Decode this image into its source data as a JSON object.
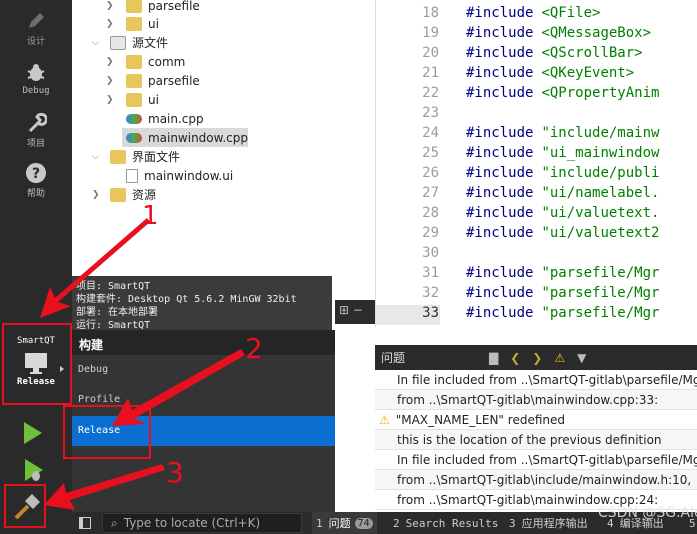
{
  "modes": [
    {
      "label": "设计",
      "icon": "design-pencil-icon"
    },
    {
      "label": "Debug",
      "icon": "bug-icon"
    },
    {
      "label": "项目",
      "icon": "wrench-icon"
    },
    {
      "label": "帮助",
      "icon": "help-icon"
    }
  ],
  "tree": {
    "rows": [
      "parsefile",
      "ui",
      "源文件",
      "comm",
      "parsefile",
      "ui",
      "main.cpp",
      "mainwindow.cpp",
      "界面文件",
      "mainwindow.ui",
      "资源"
    ]
  },
  "editor": {
    "line_numbers": [
      "18",
      "19",
      "20",
      "21",
      "22",
      "23",
      "24",
      "25",
      "26",
      "27",
      "28",
      "29",
      "30",
      "31",
      "32",
      "33"
    ],
    "include_kw": "#include",
    "lines": [
      "<QFile>",
      "<QMessageBox>",
      "<QScrollBar>",
      "<QKeyEvent>",
      "<QPropertyAnim",
      "",
      "\"include/mainw",
      "\"ui_mainwindow",
      "\"include/publi",
      "\"ui/namelabel.",
      "\"ui/valuetext.",
      "\"ui/valuetext2",
      "",
      "\"parsefile/Mgr",
      "\"parsefile/Mgr",
      "\"parsefile/Mgr"
    ]
  },
  "tooltip": {
    "lines": [
      "项目: SmartQT",
      "构建套件: Desktop Qt 5.6.2 MinGW 32bit",
      "部署: 在本地部署",
      "运行: SmartQT"
    ]
  },
  "kit_selector": {
    "project": "SmartQT",
    "build": "Release"
  },
  "build_menu": {
    "header": "构建",
    "options": [
      "Debug",
      "Profile",
      "Release"
    ],
    "selected": "Release"
  },
  "issues_panel": {
    "title": "问题",
    "rows": [
      {
        "text": "In file included from ..\\SmartQT-gitlab\\parsefile/Mg",
        "warning": false
      },
      {
        "text": "from ..\\SmartQT-gitlab\\mainwindow.cpp:33:",
        "warning": false
      },
      {
        "text": "\"MAX_NAME_LEN\" redefined",
        "warning": true
      },
      {
        "text": "this is the location of the previous definition",
        "warning": false
      },
      {
        "text": "In file included from ..\\SmartQT-gitlab\\parsefile/Mgr",
        "warning": false
      },
      {
        "text": "from ..\\SmartQT-gitlab\\include/mainwindow.h:10,",
        "warning": false
      },
      {
        "text": "from ..\\SmartQT-gitlab\\mainwindow.cpp:24:",
        "warning": false
      }
    ]
  },
  "bottom_bar": {
    "locate_placeholder": "Type to locate (Ctrl+K)",
    "tabs": [
      {
        "num": "1",
        "label": "问题",
        "badge": "74"
      },
      {
        "num": "2",
        "label": "Search Results"
      },
      {
        "num": "3",
        "label": "应用程序输出"
      },
      {
        "num": "4",
        "label": "编译输出"
      },
      {
        "num": "5",
        "label": ""
      }
    ]
  },
  "annotations": [
    "1",
    "2",
    "3"
  ],
  "watermark": "CSDN @SG.Alex",
  "colors": {
    "sidebar": "#2a2a2a",
    "accent": "#0a6fd1",
    "arrow": "#e8101e",
    "line_current": "#e8e8e8"
  }
}
